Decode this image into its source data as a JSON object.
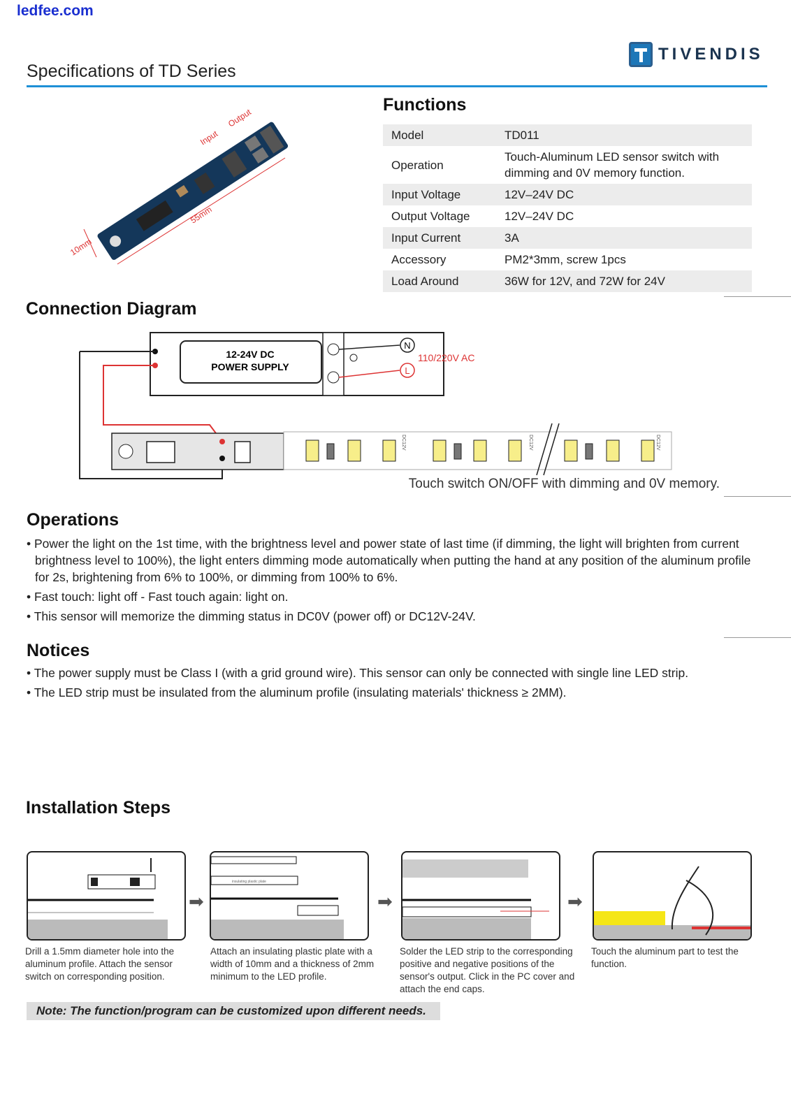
{
  "watermark": "ledfee.com",
  "brand": {
    "name": "TIVENDIS",
    "accent": "#1e90d6"
  },
  "page_title": "Specifications of TD Series",
  "product_image": {
    "input_label": "Input",
    "output_label": "Output",
    "length_label": "55mm",
    "width_label": "10mm"
  },
  "functions": {
    "heading": "Functions",
    "rows": [
      {
        "label": "Model",
        "value": "TD011"
      },
      {
        "label": "Operation",
        "value": "Touch-Aluminum LED sensor switch with dimming and 0V memory function."
      },
      {
        "label": "Input Voltage",
        "value": "12V–24V DC"
      },
      {
        "label": "Output Voltage",
        "value": "12V–24V DC"
      },
      {
        "label": "Input Current",
        "value": "3A"
      },
      {
        "label": "Accessory",
        "value": "PM2*3mm, screw 1pcs"
      },
      {
        "label": "Load Around",
        "value": "36W for 12V, and 72W for 24V"
      }
    ]
  },
  "connection": {
    "heading": "Connection Diagram",
    "psu_line1": "12-24V DC",
    "psu_line2": "POWER SUPPLY",
    "neutral": "N",
    "live": "L",
    "ac_label": "110/220V AC",
    "strip_mark": "DC12V",
    "caption": "Touch switch ON/OFF with dimming and 0V memory."
  },
  "operations": {
    "heading": "Operations",
    "items": [
      "Power the light on the 1st time, with the brightness level and power state of last time (if dimming, the light will brighten from current brightness level to 100%), the light enters dimming mode automatically when putting the hand at any position of the aluminum profile for 2s, brightening from 6% to 100%, or dimming from 100% to 6%.",
      "Fast touch: light off - Fast touch again: light on.",
      "This sensor will memorize the dimming status in DC0V (power off) or DC12V-24V."
    ]
  },
  "notices": {
    "heading": "Notices",
    "items": [
      "The power supply must be Class I (with a grid ground wire). This sensor can only be connected with single line LED strip.",
      "The LED strip must be insulated from the aluminum profile (insulating materials' thickness ≥ 2MM)."
    ]
  },
  "installation": {
    "heading": "Installation Steps",
    "plate_label": "insulating plastic plate",
    "steps": [
      "Drill a 1.5mm diameter hole into the aluminum profile. Attach the sensor switch on corresponding position.",
      "Attach an insulating plastic plate with a width of 10mm and a thickness of 2mm minimum to the LED profile.",
      "Solder the LED strip to the corresponding positive and negative positions of the sensor's output. Click in the PC cover and attach the end caps.",
      "Touch the aluminum part to test the function."
    ],
    "note": "Note: The function/program can be customized upon different needs."
  }
}
